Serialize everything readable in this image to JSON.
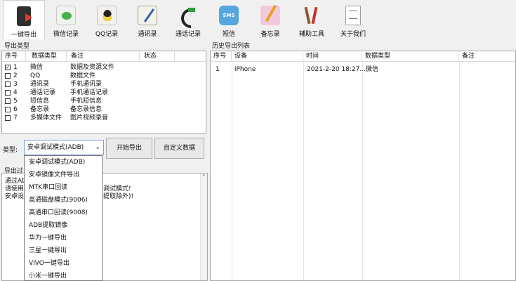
{
  "toolbar": {
    "items": [
      {
        "label": "一键导出",
        "icon": "phone-export-icon"
      },
      {
        "label": "微信记录",
        "icon": "wechat-icon"
      },
      {
        "label": "QQ记录",
        "icon": "qq-icon"
      },
      {
        "label": "通讯录",
        "icon": "contacts-book-icon"
      },
      {
        "label": "通话记录",
        "icon": "phone-calls-icon"
      },
      {
        "label": "短信",
        "icon": "sms-icon",
        "icon_text": "SMS"
      },
      {
        "label": "备忘录",
        "icon": "memo-icon"
      },
      {
        "label": "辅助工具",
        "icon": "tools-icon"
      },
      {
        "label": "关于我们",
        "icon": "document-icon"
      }
    ]
  },
  "export_types": {
    "title": "导出类型",
    "columns": [
      "序号",
      "数据类型",
      "备注",
      "状态"
    ],
    "rows": [
      {
        "index": "1",
        "type": "微信",
        "note": "数据及资源文件",
        "status": "",
        "checked": true
      },
      {
        "index": "2",
        "type": "QQ",
        "note": "数据文件",
        "status": "",
        "checked": false
      },
      {
        "index": "3",
        "type": "通讯录",
        "note": "手机通讯录",
        "status": "",
        "checked": false
      },
      {
        "index": "4",
        "type": "通话记录",
        "note": "手机通话记录",
        "status": "",
        "checked": false
      },
      {
        "index": "5",
        "type": "短信息",
        "note": "手机短信息",
        "status": "",
        "checked": false
      },
      {
        "index": "6",
        "type": "备忘录",
        "note": "备忘录信息",
        "status": "",
        "checked": false
      },
      {
        "index": "7",
        "type": "多媒体文件",
        "note": "图片视频录音",
        "status": "",
        "checked": false
      }
    ]
  },
  "history": {
    "title": "历史导出列表",
    "columns": [
      "序号",
      "设备",
      "时间",
      "数据类型",
      "备注"
    ],
    "rows": [
      {
        "index": "1",
        "device": "iPhone",
        "time": "2021-2-20 18:27...",
        "type": "微信",
        "note": ""
      }
    ]
  },
  "controls": {
    "type_label": "类型:",
    "type_value": "安卓调试模式(ADB)",
    "start_button": "开始导出",
    "custom_button": "自定义数据"
  },
  "dropdown": {
    "options": [
      "安卓调试模式(ADB)",
      "安卓镜像文件导出",
      "MTK串口回读",
      "高通磁盘模式(9006)",
      "高通串口回读(9008)",
      "ADB提取镜像",
      "华为一键导出",
      "三星一键导出",
      "VIVO一键导出",
      "小米一键导出"
    ]
  },
  "log": {
    "title": "导出过",
    "lines": [
      {
        "left": "通过ADB",
        "right": ""
      },
      {
        "left": "请使用U",
        "right": "调试模式!"
      },
      {
        "left": "安卓设备",
        "right": "提取除外)!"
      }
    ]
  }
}
